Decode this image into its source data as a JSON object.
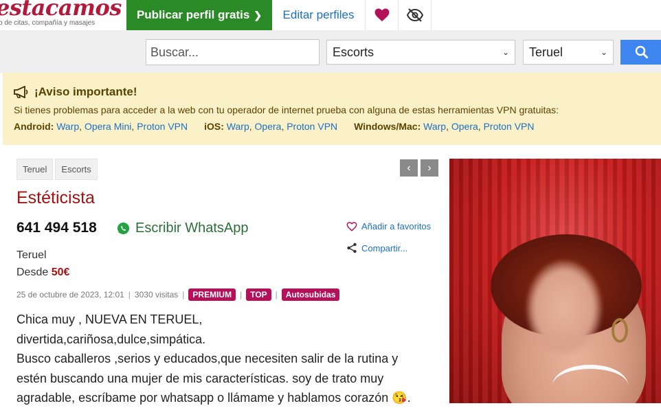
{
  "header": {
    "logo_text": "estacamos",
    "logo_subtitle": "b de citas, compañía y masajes",
    "publish_label": "Publicar perfil gratis",
    "edit_label": "Editar perfiles"
  },
  "search": {
    "placeholder": "Buscar...",
    "category": "Escorts",
    "city": "Teruel"
  },
  "notice": {
    "title": "¡Aviso importante!",
    "text": "Si tienes problemas para acceder a la web con tu operador de internet prueba con alguna de estas herramientas VPN gratuitas:",
    "groups": [
      {
        "label": "Android:",
        "links": [
          "Warp",
          "Opera Mini",
          "Proton VPN"
        ]
      },
      {
        "label": "iOS:",
        "links": [
          "Warp",
          "Opera",
          "Proton VPN"
        ]
      },
      {
        "label": "Windows/Mac:",
        "links": [
          "Warp",
          "Opera",
          "Proton VPN"
        ]
      }
    ]
  },
  "breadcrumb": [
    "Teruel",
    "Escorts"
  ],
  "ad": {
    "title": "Estéticista",
    "phone": "641 494 518",
    "whatsapp_label": "Escribir WhatsApp",
    "favorite_label": "Añadir a favoritos",
    "share_label": "Compartir...",
    "city": "Teruel",
    "price_prefix": "Desde",
    "price": "50€",
    "date": "25 de octubre de 2023, 12:01",
    "visits": "3030 visitas",
    "badges": [
      "PREMIUM",
      "TOP",
      "Autosubidas"
    ],
    "description": [
      "Chica muy , NUEVA EN TERUEL,",
      "divertida,cariñosa,dulce,simpática.",
      "Busco caballeros ,serios y educados,que necesiten salir de la rutina y",
      "estén buscando una mujer de mis características. soy de trato muy",
      "agradable, escríbame por whatsapp o llámame y hablamos corazón 😘."
    ]
  },
  "colors": {
    "brand": "#b21a3a",
    "publish_green": "#2a8a26",
    "link_blue": "#1a6fc4",
    "search_blue": "#3d86f0",
    "notice_bg": "#fbf1c8",
    "badge": "#b3125a",
    "title_red": "#a31212"
  },
  "icons": {
    "favorites": "heart-icon",
    "hide": "eye-off-icon",
    "search": "search-icon",
    "notice": "megaphone-icon",
    "whatsapp": "whatsapp-icon",
    "share": "share-icon",
    "prev": "chevron-left-icon",
    "next": "chevron-right-icon"
  }
}
